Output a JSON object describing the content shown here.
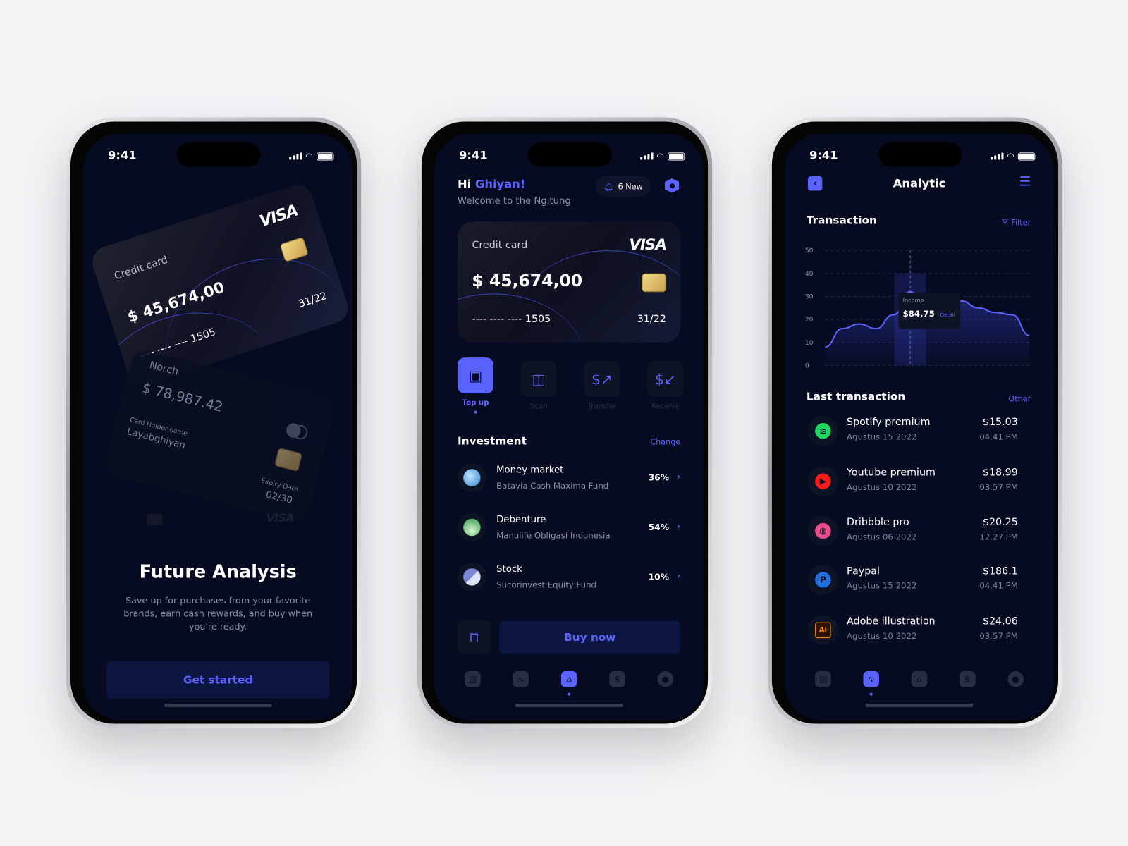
{
  "status_time": "9:41",
  "phone1": {
    "card1": {
      "label": "Credit card",
      "brand": "VISA",
      "amount": "$ 45,674,00",
      "number": "---- ---- ---- 1505",
      "expiry": "31/22"
    },
    "card2": {
      "label": "Norch",
      "amount": "$ 78,987.42",
      "holder_label": "Card Holder name",
      "holder": "Layabghiyan",
      "expiry_label": "Expiry Date",
      "expiry": "02/30",
      "brand": "VISA"
    },
    "title": "Future Analysis",
    "subtitle": "Save up for purchases from your favorite brands, earn cash rewards, and buy when you're ready.",
    "cta": "Get started"
  },
  "phone2": {
    "greeting": "Hi",
    "name": "Ghiyan!",
    "welcome": "Welcome to the Ngitung",
    "notifications": "6 New",
    "card": {
      "label": "Credit card",
      "brand": "VISA",
      "amount": "$ 45,674,00",
      "number": "---- ---- ---- 1505",
      "expiry": "31/22"
    },
    "actions": [
      {
        "label": "Top up",
        "icon": "wallet-add-icon",
        "active": true
      },
      {
        "label": "Scan",
        "icon": "scan-icon"
      },
      {
        "label": "Transfer",
        "icon": "dollar-send-icon"
      },
      {
        "label": "Receive",
        "icon": "dollar-receive-icon"
      }
    ],
    "investment_title": "Investment",
    "change": "Change",
    "investments": [
      {
        "name": "Money market",
        "fund": "Batavia Cash Maxima Fund",
        "pct": "36%"
      },
      {
        "name": "Debenture",
        "fund": "Manulife Obligasi Indonesia",
        "pct": "54%"
      },
      {
        "name": "Stock",
        "fund": "Sucorinvest Equity Fund",
        "pct": "10%"
      }
    ],
    "buy": "Buy now",
    "nav_active": "home"
  },
  "phone3": {
    "title": "Analytic",
    "section": "Transaction",
    "filter": "Filter",
    "chart_data": {
      "type": "area",
      "ylim": [
        0,
        50
      ],
      "yticks": [
        0,
        10,
        20,
        30,
        40,
        50
      ],
      "grid": true,
      "x": [
        0,
        1,
        2,
        3,
        4,
        5,
        6,
        7,
        8,
        9,
        10,
        11,
        12
      ],
      "values": [
        8,
        16,
        18,
        16,
        22,
        30,
        26,
        23,
        28,
        25,
        23,
        22,
        13
      ],
      "highlight": {
        "index": 5,
        "label": "Income",
        "value": "$84,75",
        "action": "Detail"
      }
    },
    "last_title": "Last transaction",
    "other": "Other",
    "transactions": [
      {
        "name": "Spotify premium",
        "date": "Agustus 15 2022",
        "amount": "$15.03",
        "time": "04.41 PM",
        "icon": "spotify-icon",
        "color": "#1ed760"
      },
      {
        "name": "Youtube premium",
        "date": "Agustus 10 2022",
        "amount": "$18.99",
        "time": "03.57 PM",
        "icon": "youtube-icon",
        "color": "#ff1a1a"
      },
      {
        "name": "Dribbble pro",
        "date": "Agustus 06 2022",
        "amount": "$20.25",
        "time": "12.27 PM",
        "icon": "dribbble-icon",
        "color": "#ea4c89"
      },
      {
        "name": "Paypal",
        "date": "Agustus 15 2022",
        "amount": "$186.1",
        "time": "04.41 PM",
        "icon": "paypal-icon",
        "color": "#1f6fe0"
      },
      {
        "name": "Adobe illustration",
        "date": "Agustus 10 2022",
        "amount": "$24.06",
        "time": "03.57 PM",
        "icon": "illustrator-icon",
        "color": "#ff8a00"
      }
    ],
    "nav_active": "analytics"
  },
  "colors": {
    "accent": "#5b63ff",
    "background": "#060b22"
  }
}
